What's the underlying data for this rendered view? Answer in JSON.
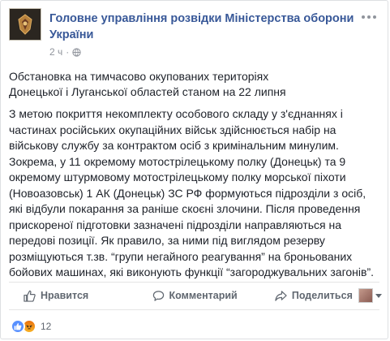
{
  "post": {
    "page_name": "Головне управління розвідки Міністерства оборони України",
    "time": "2 ч",
    "title_line1": "Обстановка на тимчасово окупованих територіях",
    "title_line2": "Донецької і Луганської областей станом на 22 липня",
    "body": "З метою покриття некомплекту особового складу у з'єднаннях і частинах російських окупаційних військ здійснюється набір на військову службу за контрактом осіб з кримінальним минулим. Зокрема, у 11 окремому мотострілецькому полку (Донецьк) та 9 окремому штурмовому мотострілецькому полку морської піхоти (Новоазовськ) 1 АК (Донецьк) ЗС РФ формуються підрозділи з осіб, які відбули покарання за раніше скоєні злочини. Після проведення прискореної підготовки зазначені підрозділи направляються на передові позиції. Як правило, за ними під виглядом резерву розміщуються т.зв. “групи негайного реагування” на броньованих бойових машинах, які виконують функції “загороджувальних загонів”."
  },
  "actions": {
    "like": "Нравится",
    "comment": "Комментарий",
    "share": "Поделиться"
  },
  "reactions": {
    "count": "12"
  },
  "icons": {
    "globe": "globe-icon",
    "more": "more-options-icon",
    "like": "thumbs-up-icon",
    "comment": "speech-bubble-icon",
    "share": "share-arrow-icon"
  },
  "colors": {
    "link": "#385898",
    "meta": "#90949c",
    "like_reaction": "#5890ff",
    "angry_reaction": "#e9710f"
  }
}
